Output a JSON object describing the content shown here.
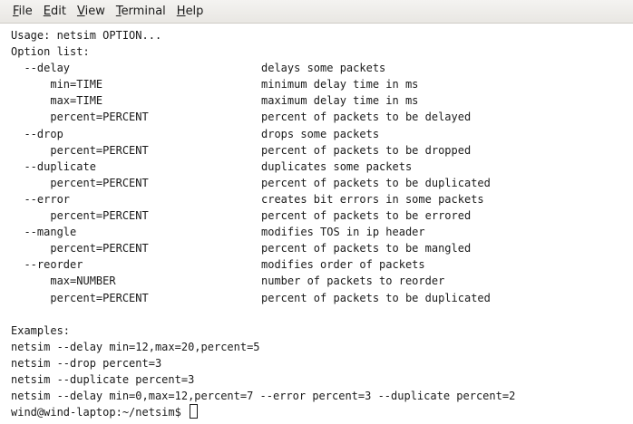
{
  "menubar": {
    "items": [
      {
        "mnemonic": "F",
        "rest": "ile"
      },
      {
        "mnemonic": "E",
        "rest": "dit"
      },
      {
        "mnemonic": "V",
        "rest": "iew"
      },
      {
        "mnemonic": "T",
        "rest": "erminal"
      },
      {
        "mnemonic": "H",
        "rest": "elp"
      }
    ]
  },
  "terminal": {
    "usage": "Usage: netsim OPTION...",
    "option_list_header": "Option list:",
    "options": [
      {
        "opt": "  --delay",
        "desc": "delays some packets"
      },
      {
        "opt": "      min=TIME",
        "desc": "minimum delay time in ms"
      },
      {
        "opt": "      max=TIME",
        "desc": "maximum delay time in ms"
      },
      {
        "opt": "      percent=PERCENT",
        "desc": "percent of packets to be delayed"
      },
      {
        "opt": "  --drop",
        "desc": "drops some packets"
      },
      {
        "opt": "      percent=PERCENT",
        "desc": "percent of packets to be dropped"
      },
      {
        "opt": "  --duplicate",
        "desc": "duplicates some packets"
      },
      {
        "opt": "      percent=PERCENT",
        "desc": "percent of packets to be duplicated"
      },
      {
        "opt": "  --error",
        "desc": "creates bit errors in some packets"
      },
      {
        "opt": "      percent=PERCENT",
        "desc": "percent of packets to be errored"
      },
      {
        "opt": "  --mangle",
        "desc": "modifies TOS in ip header"
      },
      {
        "opt": "      percent=PERCENT",
        "desc": "percent of packets to be mangled"
      },
      {
        "opt": "  --reorder",
        "desc": "modifies order of packets"
      },
      {
        "opt": "      max=NUMBER",
        "desc": "number of packets to reorder"
      },
      {
        "opt": "      percent=PERCENT",
        "desc": "percent of packets to be duplicated"
      }
    ],
    "examples_header": "Examples:",
    "examples": [
      "netsim --delay min=12,max=20,percent=5",
      "netsim --drop percent=3",
      "netsim --duplicate percent=3",
      "netsim --delay min=0,max=12,percent=7 --error percent=3 --duplicate percent=2"
    ],
    "prompt": "wind@wind-laptop:~/netsim$ "
  }
}
